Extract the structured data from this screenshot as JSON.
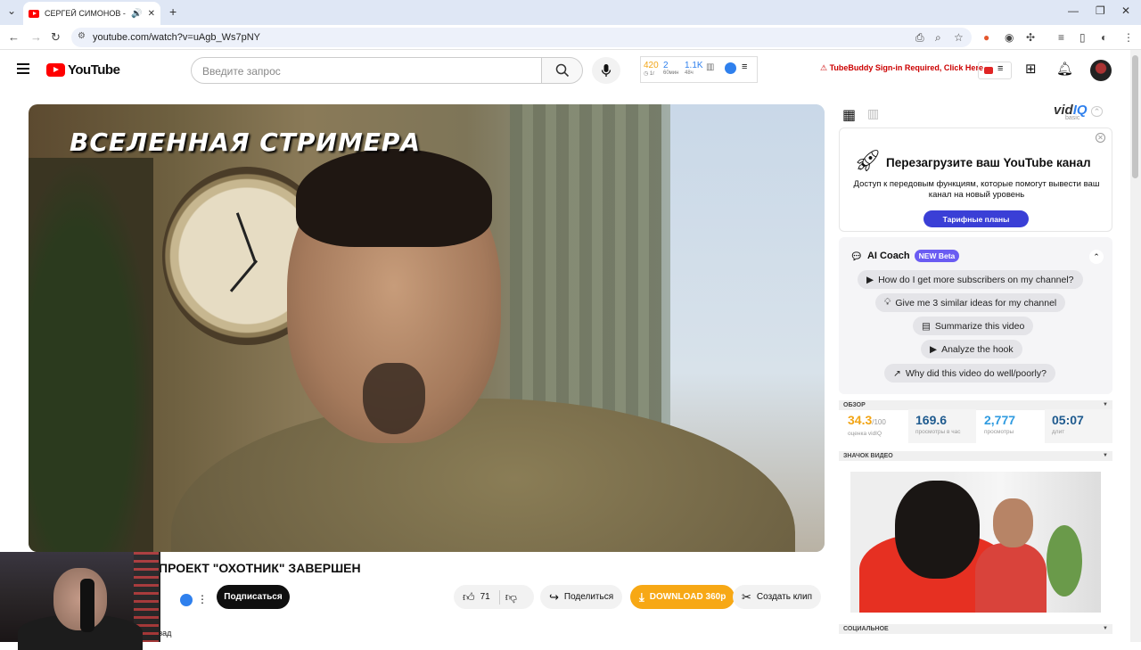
{
  "browser": {
    "tab_title": "СЕРГЕЙ СИМОНОВ - ПРО",
    "url": "youtube.com/watch?v=uAgb_Ws7pNY"
  },
  "header": {
    "logo_text": "YouTube",
    "search_placeholder": "Введите запрос",
    "stats": {
      "v1": "420",
      "l1": "1г",
      "v2": "2",
      "l2": "60мин",
      "v3": "1.1K",
      "l3": "48ч"
    },
    "tubebuddy_warning": "TubeBuddy Sign-in Required, Click Here"
  },
  "video": {
    "overlay_title": "ВСЕЛЕННАЯ СТРИМЕРА",
    "title": "ПРОЕКТ \"ОХОТНИК\" ЗАВЕРШЕН",
    "subscribe_label": "Подписаться",
    "likes": "71",
    "share_label": "Поделиться",
    "download_label": "DOWNLOAD 360p",
    "clip_label": "Создать клип",
    "desc_peek": "зад"
  },
  "sidebar": {
    "logo_vid": "vid",
    "logo_iq": "IQ",
    "plan": "basic",
    "promo": {
      "title": "Перезагрузите ваш YouTube канал",
      "text": "Доступ к передовым функциям, которые помогут вывести ваш канал на новый уровень",
      "button": "Тарифные планы"
    },
    "coach": {
      "title": "AI Coach",
      "badge": "NEW Beta",
      "questions": [
        "How do I get more subscribers on my channel?",
        "Give me 3 similar ideas for my channel",
        "Summarize this video",
        "Analyze the hook",
        "Why did this video do well/poorly?"
      ]
    },
    "overview": {
      "header": "ОБЗОР",
      "score": "34.3",
      "score_max": "/100",
      "score_label": "оценка vidIQ",
      "vph": "169.6",
      "vph_label": "просмотры в час",
      "views": "2,777",
      "views_label": "просмотры",
      "length": "05:07",
      "length_label": "длит"
    },
    "thumb_header": "ЗНАЧОК ВИДЕО",
    "social_header": "СОЦИАЛЬНОЕ"
  },
  "colors": {
    "youtube_red": "#ff0000",
    "download_orange": "#f7a815",
    "vidiq_blue": "#2f80ed",
    "promo_button": "#3a3fd6",
    "score_orange": "#f2a516",
    "new_badge": "#6a5cf2"
  }
}
